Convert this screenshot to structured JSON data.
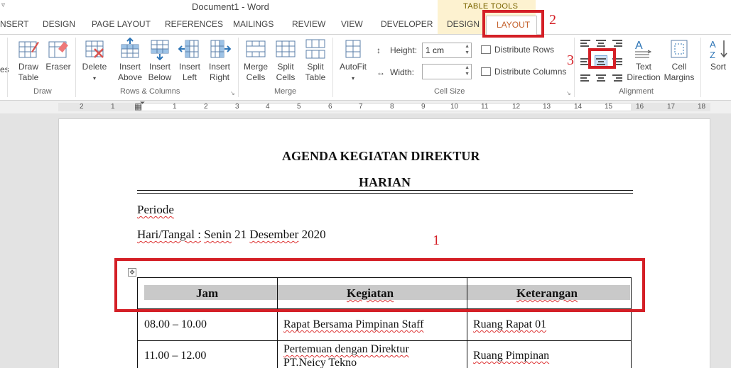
{
  "window": {
    "title": "Document1 - Word",
    "context_label": "TABLE TOOLS"
  },
  "tabs": [
    {
      "label": "NSERT"
    },
    {
      "label": "DESIGN"
    },
    {
      "label": "PAGE LAYOUT"
    },
    {
      "label": "REFERENCES"
    },
    {
      "label": "MAILINGS"
    },
    {
      "label": "REVIEW"
    },
    {
      "label": "VIEW"
    },
    {
      "label": "DEVELOPER"
    },
    {
      "label": "DESIGN"
    },
    {
      "label": "LAYOUT"
    }
  ],
  "ribbon": {
    "edge_label": "es",
    "draw": {
      "group": "Draw",
      "draw_table": [
        "Draw",
        "Table"
      ],
      "eraser": "Eraser"
    },
    "rows_columns": {
      "group": "Rows & Columns",
      "delete": "Delete",
      "insert_above": [
        "Insert",
        "Above"
      ],
      "insert_below": [
        "Insert",
        "Below"
      ],
      "insert_left": [
        "Insert",
        "Left"
      ],
      "insert_right": [
        "Insert",
        "Right"
      ]
    },
    "merge": {
      "group": "Merge",
      "merge_cells": [
        "Merge",
        "Cells"
      ],
      "split_cells": [
        "Split",
        "Cells"
      ],
      "split_table": [
        "Split",
        "Table"
      ]
    },
    "cell_size": {
      "group": "Cell Size",
      "autofit": "AutoFit",
      "height_label": "Height:",
      "height_value": "1 cm",
      "width_label": "Width:",
      "width_value": "",
      "distribute_rows": "Distribute Rows",
      "distribute_columns": "Distribute Columns"
    },
    "alignment": {
      "group": "Alignment",
      "text_direction": [
        "Text",
        "Direction"
      ],
      "cell_margins": [
        "Cell",
        "Margins"
      ]
    },
    "sort": "Sort"
  },
  "ruler": {
    "marks": [
      "2",
      "1",
      "1",
      "2",
      "3",
      "4",
      "5",
      "6",
      "7",
      "8",
      "9",
      "10",
      "11",
      "12",
      "13",
      "14",
      "15",
      "16",
      "17",
      "18"
    ]
  },
  "document": {
    "heading1": "AGENDA KEGIATAN DIREKTUR",
    "heading2": "HARIAN",
    "periode": "Periode",
    "hari_label": "Hari/Tangal :",
    "hari_rest1": "Senin",
    "hari_rest2": "21",
    "hari_rest3": "Desember",
    "hari_rest4": "2020",
    "table": {
      "headers": [
        "Jam",
        "Kegiatan",
        "Keterangan"
      ],
      "rows": [
        {
          "jam": "08.00 – 10.00",
          "kegiatan": [
            "Rapat Bersama Pimpinan Staff"
          ],
          "keterangan": "Ruang Rapat 01"
        },
        {
          "jam": "11.00 – 12.00",
          "kegiatan": [
            "Pertemuan dengan Direktur",
            "PT.Neicy Tekno"
          ],
          "keterangan": "Ruang Pimpinan"
        }
      ]
    }
  },
  "annotations": {
    "one": "1",
    "two": "2",
    "three": "3",
    "color": "#d41f26"
  }
}
